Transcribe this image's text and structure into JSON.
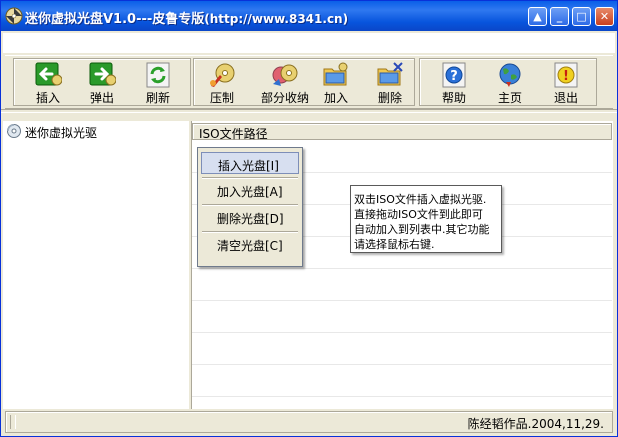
{
  "window": {
    "title_main": "迷你虚拟光盘V1.0---皮鲁专版",
    "title_url": "(http://www.8341.cn)",
    "min_glyph": "_",
    "max_glyph": "□",
    "close_glyph": "✕",
    "up_glyph": "▲"
  },
  "toolbar": {
    "insert": "插入",
    "eject": "弹出",
    "refresh": "刷新",
    "burn": "压制",
    "partial": "部分收纳",
    "add": "加入",
    "delete": "删除",
    "help": "帮助",
    "home": "主页",
    "exit": "退出"
  },
  "tree": {
    "root": "迷你虚拟光驱"
  },
  "list": {
    "header": "ISO文件路径"
  },
  "context_menu": {
    "insert_disc": "插入光盘[I]",
    "add_disc": "加入光盘[A]",
    "delete_disc": "删除光盘[D]",
    "clear_discs": "清空光盘[C]"
  },
  "tooltip": {
    "line1": "双击ISO文件插入虚拟光驱.",
    "line2": "直接拖动ISO文件到此即可",
    "line3": "自动加入到列表中.其它功能",
    "line4": "请选择鼠标右键."
  },
  "status": {
    "text": "陈经韬作品.2004,11,29."
  },
  "colors": {
    "titlebar": "#0a5fe8",
    "window_bg": "#ece9d8",
    "accent": "#0831d9"
  },
  "icons": {
    "app": "cd-icon",
    "insert": "arrow-left-icon",
    "eject": "arrow-right-icon",
    "refresh": "refresh-icon",
    "burn": "burn-disc-icon",
    "partial": "disc-stack-icon",
    "add": "folder-add-icon",
    "delete": "folder-delete-icon",
    "help": "help-icon",
    "home": "globe-icon",
    "exit": "exit-icon"
  }
}
